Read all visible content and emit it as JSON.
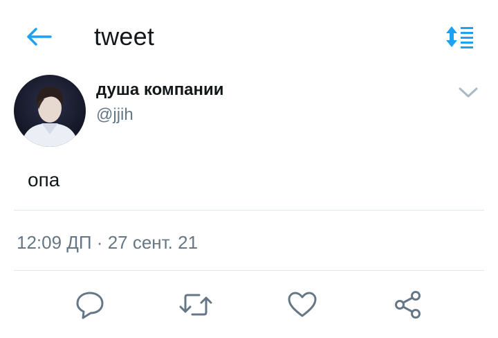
{
  "header": {
    "title": "tweet",
    "back_icon": "arrow-left-icon",
    "sort_icon": "sort-order-icon",
    "accent_color": "#1da1f2"
  },
  "tweet": {
    "author": {
      "display_name": "душа компании",
      "handle": "@jjih",
      "avatar_icon": "profile-photo"
    },
    "text": "опа",
    "timestamp": "12:09 ДП · 27 сент. 21"
  },
  "actions": [
    {
      "name": "reply",
      "icon": "speech-bubble-icon"
    },
    {
      "name": "retweet",
      "icon": "retweet-icon"
    },
    {
      "name": "like",
      "icon": "heart-icon"
    },
    {
      "name": "share",
      "icon": "share-icon"
    }
  ],
  "colors": {
    "text_primary": "#14171a",
    "text_secondary": "#657786",
    "divider": "#e1e8ed"
  }
}
